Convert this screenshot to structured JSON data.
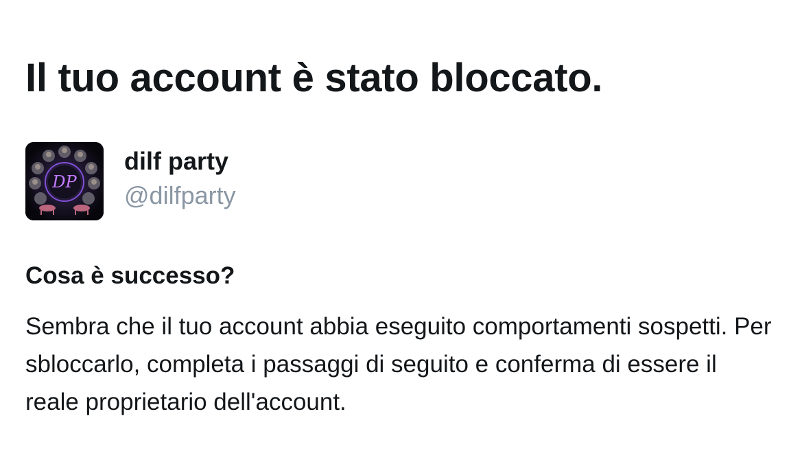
{
  "title": "Il tuo account è stato bloccato.",
  "account": {
    "display_name": "dilf party",
    "handle": "@dilfparty",
    "avatar_icon": "profile-avatar-icon",
    "avatar_monogram": "DP"
  },
  "section": {
    "heading": "Cosa è successo?",
    "body": "Sembra che il tuo account abbia eseguito comportamenti sospetti. Per sbloccarlo, completa i passaggi di seguito e conferma di essere il reale proprietario dell'account."
  },
  "colors": {
    "primary_text": "#14171a",
    "secondary_text": "#8a96a3",
    "background": "#ffffff"
  }
}
